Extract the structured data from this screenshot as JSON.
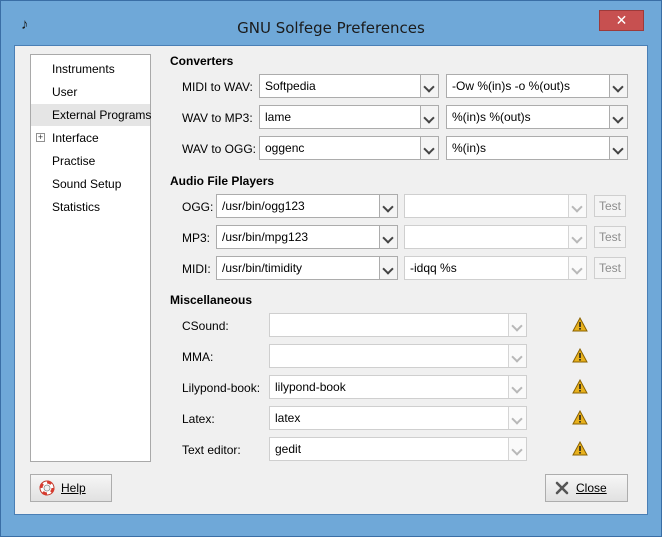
{
  "window": {
    "title": "GNU Solfege Preferences",
    "close_glyph": "✕",
    "app_icon": "music-note-icon"
  },
  "sidebar": {
    "items": [
      {
        "label": "Instruments",
        "selected": false,
        "expandable": false
      },
      {
        "label": "User",
        "selected": false,
        "expandable": false
      },
      {
        "label": "External Programs",
        "selected": true,
        "expandable": false
      },
      {
        "label": "Interface",
        "selected": false,
        "expandable": true
      },
      {
        "label": "Practise",
        "selected": false,
        "expandable": false
      },
      {
        "label": "Sound Setup",
        "selected": false,
        "expandable": false
      },
      {
        "label": "Statistics",
        "selected": false,
        "expandable": false
      }
    ],
    "expander_glyph": "+"
  },
  "converters": {
    "title": "Converters",
    "rows": [
      {
        "label": "MIDI to WAV:",
        "program": "Softpedia",
        "args": "-Ow %(in)s -o %(out)s"
      },
      {
        "label": "WAV to MP3:",
        "program": "lame",
        "args": "%(in)s %(out)s"
      },
      {
        "label": "WAV to OGG:",
        "program": "oggenc",
        "args": "%(in)s"
      }
    ]
  },
  "players": {
    "title": "Audio File Players",
    "test_label": "Test",
    "rows": [
      {
        "label": "OGG:",
        "program": "/usr/bin/ogg123",
        "args": ""
      },
      {
        "label": "MP3:",
        "program": "/usr/bin/mpg123",
        "args": ""
      },
      {
        "label": "MIDI:",
        "program": "/usr/bin/timidity",
        "args": "-idqq %s"
      }
    ]
  },
  "misc": {
    "title": "Miscellaneous",
    "rows": [
      {
        "label": "CSound:",
        "value": ""
      },
      {
        "label": "MMA:",
        "value": ""
      },
      {
        "label": "Lilypond-book:",
        "value": "lilypond-book"
      },
      {
        "label": "Latex:",
        "value": "latex"
      },
      {
        "label": "Text editor:",
        "value": "gedit"
      }
    ],
    "warning_icon": "warning-icon"
  },
  "buttons": {
    "help": "Help",
    "close": "Close"
  },
  "colors": {
    "titlebar": "#6fa8d8",
    "close": "#c75050",
    "selected_item": "#e5e5e5",
    "warning": "#e8b11c"
  }
}
